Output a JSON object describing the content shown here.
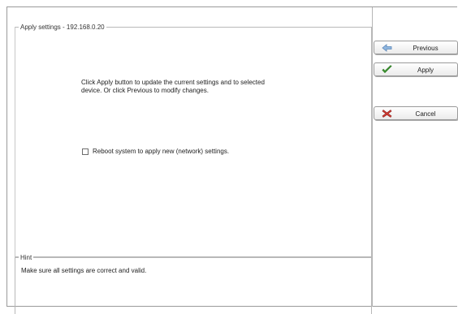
{
  "apply_panel": {
    "legend": "Apply settings - 192.168.0.20",
    "description_line1": "Click Apply button to update the current settings and to selected",
    "description_line2": "device. Or click Previous to modify changes.",
    "reboot_label": "Reboot system to apply  new (network) settings.",
    "reboot_checked": false
  },
  "hint_panel": {
    "legend": "Hint",
    "text": "Make sure all settings are correct and valid."
  },
  "buttons": {
    "previous": {
      "label": "Previous",
      "icon": "arrow-left-icon"
    },
    "apply": {
      "label": "Apply",
      "icon": "checkmark-icon"
    },
    "cancel": {
      "label": "Cancel",
      "icon": "cross-icon"
    }
  },
  "colors": {
    "previous_icon": "#7fa9d6",
    "apply_icon": "#3a9a2e",
    "cancel_icon": "#c0302a"
  }
}
